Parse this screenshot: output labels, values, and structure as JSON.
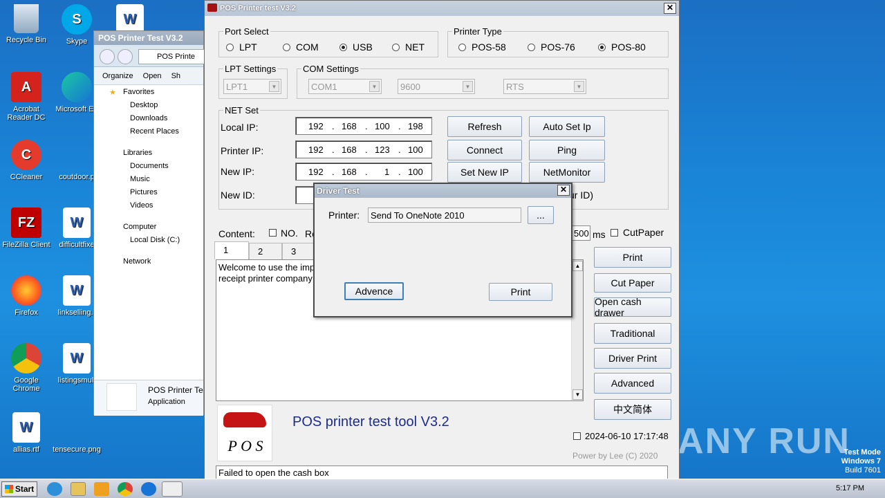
{
  "desktop": {
    "icons": [
      {
        "label": "Recycle Bin"
      },
      {
        "label": "Skype"
      },
      {
        "label": "Acrobat Reader DC"
      },
      {
        "label": "Microsoft Ed"
      },
      {
        "label": "CCleaner"
      },
      {
        "label": "coutdoor.p"
      },
      {
        "label": "FileZilla Client"
      },
      {
        "label": "difficultfixe"
      },
      {
        "label": "Firefox"
      },
      {
        "label": "linkselling.r"
      },
      {
        "label": "Google Chrome"
      },
      {
        "label": "listingsmult"
      },
      {
        "label": "allias.rtf"
      },
      {
        "label": "tensecure.png"
      }
    ],
    "watermark": "ANY RUN",
    "test_mode": {
      "line1": "Test Mode",
      "line2": "Windows 7",
      "line3": "Build 7601"
    }
  },
  "taskbar": {
    "start_label": "Start",
    "clock": "5:17 PM"
  },
  "explorer": {
    "title": "POS Printer Test V3.2",
    "address": "POS Printe",
    "toolbar": {
      "organize": "Organize",
      "open": "Open",
      "share": "Sh"
    },
    "nav": {
      "favorites": "Favorites",
      "desktop": "Desktop",
      "downloads": "Downloads",
      "recent": "Recent Places",
      "libraries": "Libraries",
      "documents": "Documents",
      "music": "Music",
      "pictures": "Pictures",
      "videos": "Videos",
      "computer": "Computer",
      "local_disk": "Local Disk (C:)",
      "network": "Network"
    },
    "selected_file": {
      "name": "POS Printer Te",
      "type": "Application"
    }
  },
  "main": {
    "title": "POS Printer test V3.2",
    "port_select": {
      "legend": "Port Select",
      "options": [
        "LPT",
        "COM",
        "USB",
        "NET"
      ],
      "selected": "USB"
    },
    "printer_type": {
      "legend": "Printer Type",
      "options": [
        "POS-58",
        "POS-76",
        "POS-80"
      ],
      "selected": "POS-80"
    },
    "lpt_settings": {
      "legend": "LPT Settings",
      "value": "LPT1"
    },
    "com_settings": {
      "legend": "COM Settings",
      "port": "COM1",
      "baud": "9600",
      "flow": "RTS"
    },
    "net_set": {
      "legend": "NET Set",
      "local_ip_label": "Local IP:",
      "local_ip": [
        "192",
        "168",
        "100",
        "198"
      ],
      "printer_ip_label": "Printer IP:",
      "printer_ip": [
        "192",
        "168",
        "123",
        "100"
      ],
      "new_ip_label": "New IP:",
      "new_ip": [
        "192",
        "168",
        "1",
        "100"
      ],
      "new_id_label": "New ID:",
      "id_hint": "ur ID)",
      "buttons": {
        "refresh": "Refresh",
        "auto_set_ip": "Auto Set Ip",
        "connect": "Connect",
        "ping": "Ping",
        "set_new_ip": "Set New IP",
        "net_monitor": "NetMonitor"
      }
    },
    "content_label": "Content:",
    "no_label": "NO.",
    "re_label": "Re",
    "interval_value": "500",
    "ms_label": "ms",
    "cut_paper_check": "CutPaper",
    "tabs": [
      "1",
      "2",
      "3"
    ],
    "content_text": "Welcome to use the imp\nreceipt printer company",
    "side_buttons": {
      "print": "Print",
      "cut_paper": "Cut Paper",
      "open_cash_drawer": "Open cash drawer",
      "traditional": "Traditional",
      "driver_print": "Driver Print",
      "advanced": "Advanced",
      "chinese": "中文简体"
    },
    "app_name": "POS printer test tool V3.2",
    "datetime": "2024-06-10 17:17:48",
    "powered_by": "Power by Lee (C) 2020",
    "status": "Failed to open the cash box",
    "logo_text": "P O S"
  },
  "dialog": {
    "title": "Driver Test",
    "printer_label": "Printer:",
    "printer_value": "Send To OneNote 2010",
    "browse_label": "...",
    "advence_label": "Advence",
    "print_label": "Print"
  },
  "colors": {
    "desktop_blue": "#1a84d6",
    "app_title_text": "#1d2b8a"
  }
}
